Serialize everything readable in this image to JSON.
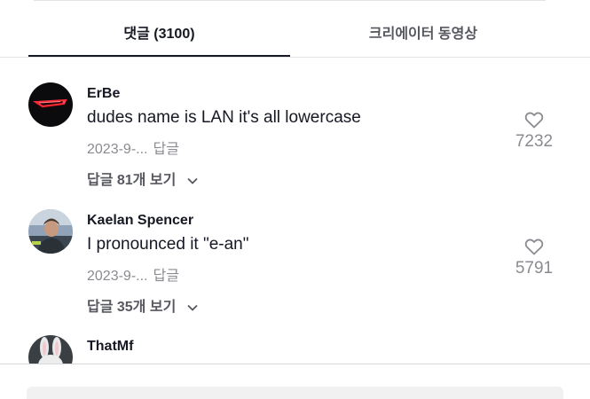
{
  "tabs": {
    "comments": "댓글 (3100)",
    "creator_videos": "크리에이터 동영상"
  },
  "comments": [
    {
      "username": "ErBe",
      "text": "dudes name is LAN it's all lowercase",
      "date": "2023-9-...",
      "reply_label": "답글",
      "view_replies": "답글 81개 보기",
      "likes": "7232",
      "avatar_icon": "car-taillight-avatar"
    },
    {
      "username": "Kaelan Spencer",
      "text": "I pronounced it \"e-an\"",
      "date": "2023-9-...",
      "reply_label": "답글",
      "view_replies": "답글 35개 보기",
      "likes": "5791",
      "avatar_icon": "person-photo-avatar"
    },
    {
      "username": "ThatMf",
      "avatar_icon": "bunny-avatar"
    }
  ],
  "icons": {
    "like": "heart-outline-icon",
    "chevron": "chevron-down-icon"
  },
  "colors": {
    "text_primary": "#161823",
    "text_secondary": "#8a8b91",
    "tab_underline": "#161823",
    "input_bg": "#f1f1f2"
  }
}
